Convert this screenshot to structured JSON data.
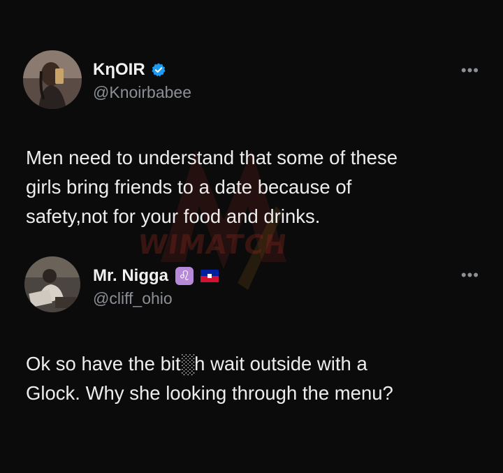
{
  "tweets": [
    {
      "author": {
        "display_name": "KηOIR",
        "handle": "@Knoirbabee",
        "verified": true,
        "badge_icon": "verified-badge-icon"
      },
      "text": "Men need to understand that some of these\ngirls bring friends to a date because of\nsafety,not for your food and drinks.",
      "more_icon": "•••"
    },
    {
      "author": {
        "display_name": "Mr. Nigga",
        "handle": "@cliff_ohio",
        "emoji_badges": [
          "leo-zodiac-icon",
          "haiti-flag-icon"
        ],
        "leo_glyph": "♌"
      },
      "text": "Ok so have the bit░h wait outside with a\nGlock. Why she looking through the menu?",
      "more_icon": "•••"
    }
  ],
  "watermark": {
    "text": "WIMATCH",
    "color": "#8c281e"
  },
  "colors": {
    "background": "#0b0b0c",
    "primary_text": "#ededed",
    "secondary_text": "#8b9096",
    "verified_blue": "#1d9bf0",
    "leo_badge": "#b68ad8"
  }
}
